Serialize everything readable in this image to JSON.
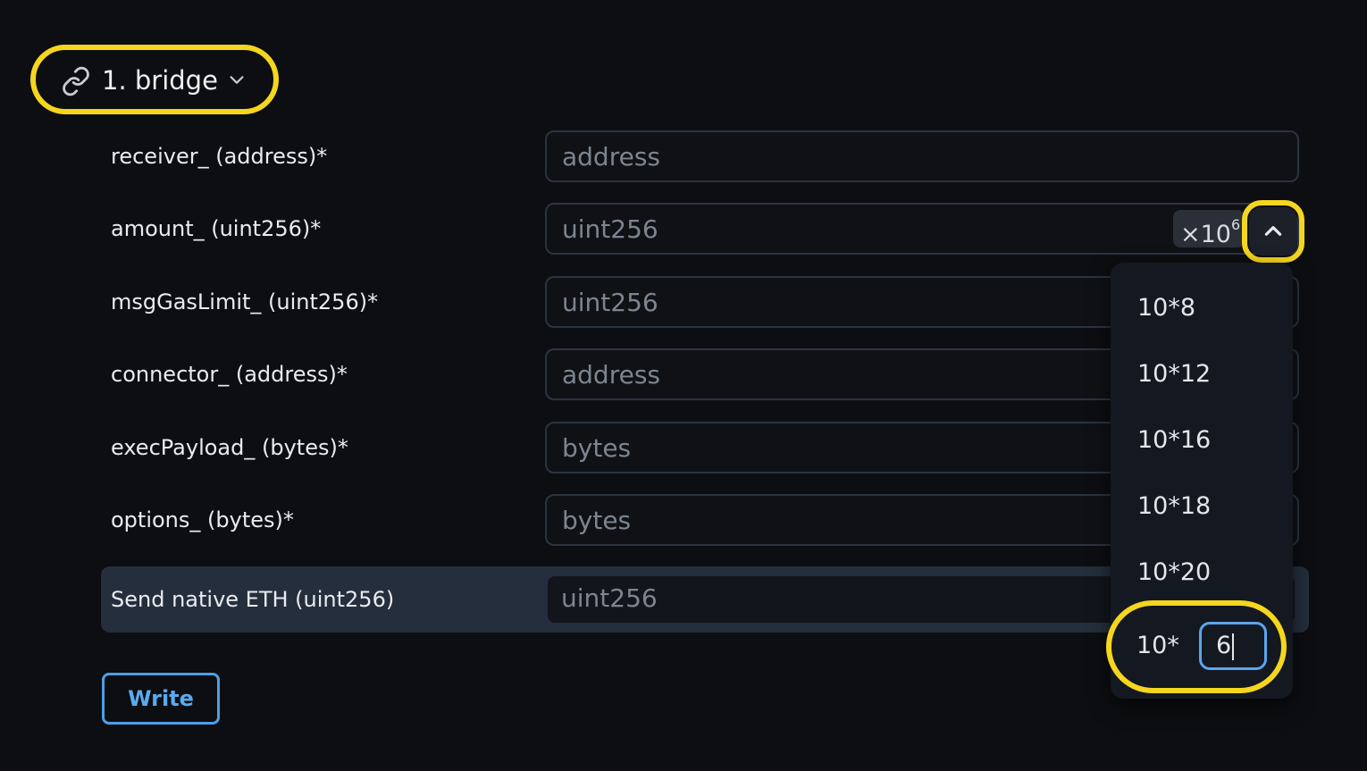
{
  "method": {
    "title": "1. bridge",
    "icon": "link-icon",
    "chevron": "chevron-down-icon"
  },
  "params": [
    {
      "label": "receiver_ (address)*",
      "placeholder": "address"
    },
    {
      "label": "amount_ (uint256)*",
      "placeholder": "uint256"
    },
    {
      "label": "msgGasLimit_ (uint256)*",
      "placeholder": "uint256"
    },
    {
      "label": "connector_ (address)*",
      "placeholder": "address"
    },
    {
      "label": "execPayload_ (bytes)*",
      "placeholder": "bytes"
    },
    {
      "label": "options_ (bytes)*",
      "placeholder": "bytes"
    }
  ],
  "native": {
    "label": "Send native ETH (uint256)",
    "placeholder": "uint256"
  },
  "multiplier": {
    "base": "×10",
    "exp": "6",
    "toggle_icon": "chevron-up-icon"
  },
  "dropdown": {
    "options": [
      "10*8",
      "10*12",
      "10*16",
      "10*18",
      "10*20"
    ],
    "custom_prefix": "10*",
    "custom_value": "6"
  },
  "write_label": "Write",
  "colors": {
    "highlight": "#f5d61e",
    "accent": "#4e9ee8"
  }
}
